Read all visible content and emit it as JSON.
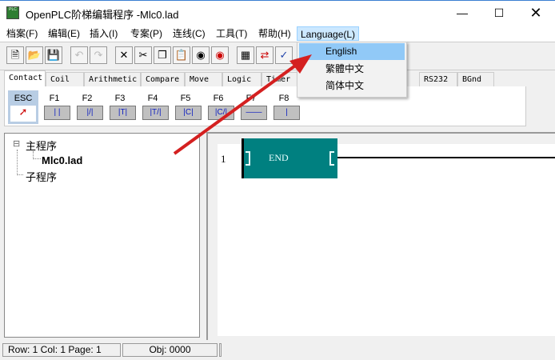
{
  "window": {
    "title": "OpenPLC阶梯编辑程序 -Mlc0.lad",
    "icon": "app-icon",
    "controls": [
      "minimize",
      "maximize",
      "close"
    ]
  },
  "menu": [
    {
      "label": "档案(F)"
    },
    {
      "label": "编辑(E)"
    },
    {
      "label": "插入(I)"
    },
    {
      "label": "专案(P)"
    },
    {
      "label": "连线(C)"
    },
    {
      "label": "工具(T)"
    },
    {
      "label": "帮助(H)"
    },
    {
      "label": "Language(L)"
    }
  ],
  "language_menu": [
    {
      "label": "English",
      "highlighted": true
    },
    {
      "label": "繁體中文"
    },
    {
      "label": "简体中文"
    }
  ],
  "toolbar": [
    "new",
    "open",
    "save",
    "undo",
    "redo",
    "delete",
    "cut",
    "copy",
    "paste",
    "find",
    "find-next",
    "compile",
    "monitor",
    "verify"
  ],
  "tabs": [
    {
      "label": "Contact",
      "active": true
    },
    {
      "label": "Coil"
    },
    {
      "label": "Arithmetic"
    },
    {
      "label": "Compare"
    },
    {
      "label": "Move"
    },
    {
      "label": "Logic"
    },
    {
      "label": "Timer"
    },
    {
      "label": "RS232"
    },
    {
      "label": "BGnd"
    }
  ],
  "palette": {
    "esc": "ESC",
    "keys": [
      {
        "key": "F1",
        "sym": "| |"
      },
      {
        "key": "F2",
        "sym": "|/|"
      },
      {
        "key": "F3",
        "sym": "|T|"
      },
      {
        "key": "F4",
        "sym": "|T/|"
      },
      {
        "key": "F5",
        "sym": "|C|"
      },
      {
        "key": "F6",
        "sym": "|C/|"
      },
      {
        "key": "F7",
        "sym": "——"
      },
      {
        "key": "F8",
        "sym": "|"
      }
    ]
  },
  "tree": {
    "root": "主程序",
    "child": "Mlc0.lad",
    "sub": "子程序",
    "expander": "⊟"
  },
  "ladder": {
    "row": "1",
    "block": "END",
    "block_color": "#008080"
  },
  "status": {
    "pos": "Row: 1  Col: 1  Page: 1",
    "obj": "Obj: 0000"
  },
  "colors": {
    "arrow": "#d42020",
    "menu_highlight": "#91c9f7"
  }
}
